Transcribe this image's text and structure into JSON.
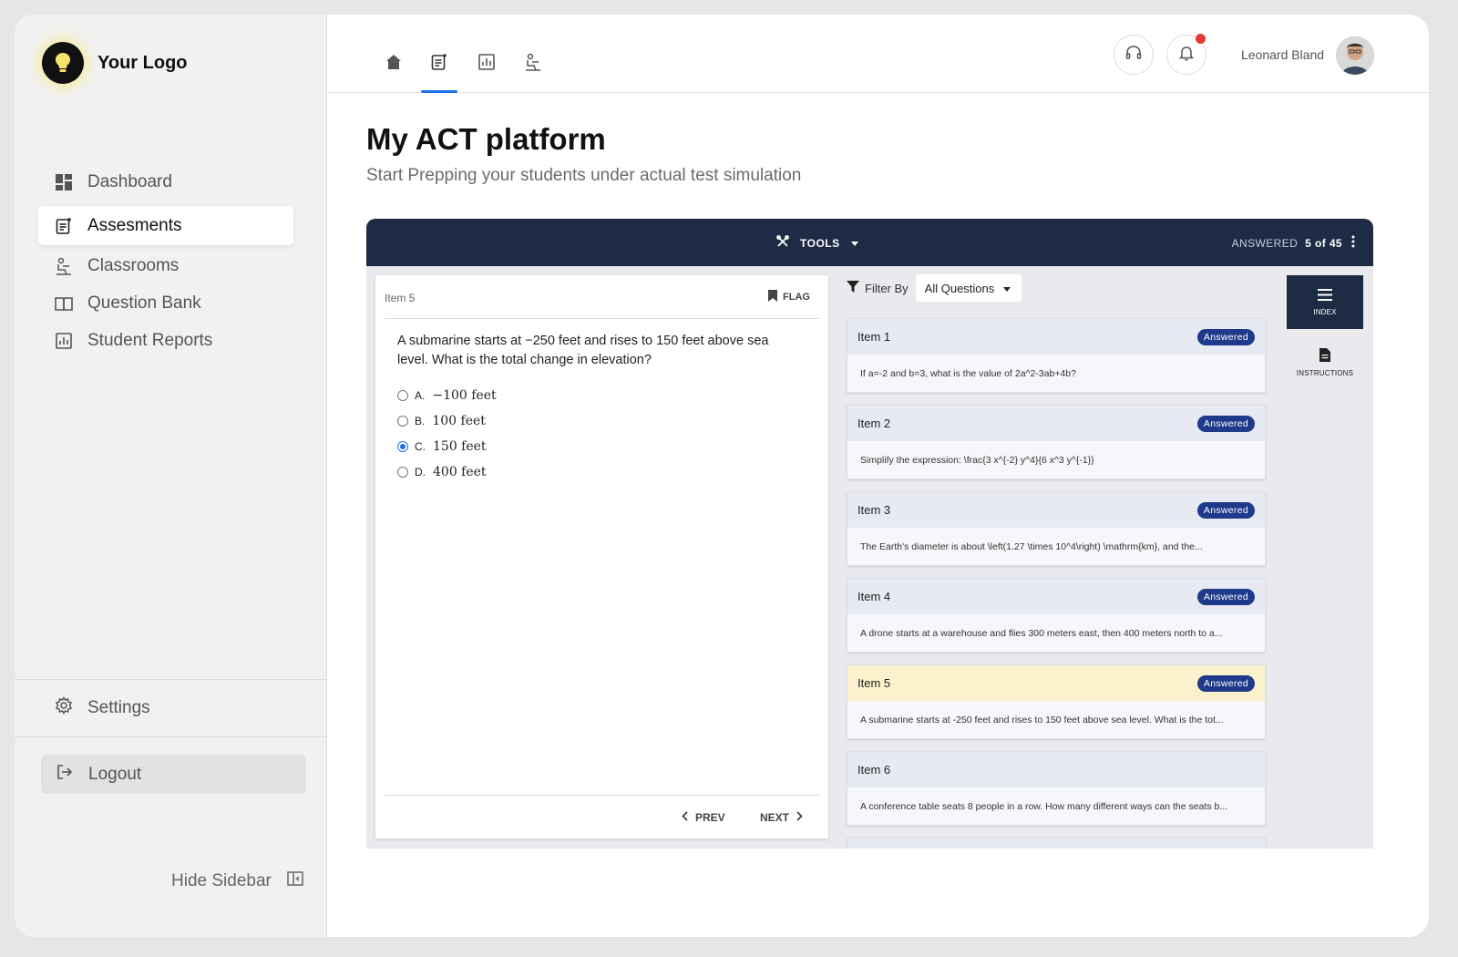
{
  "brand": {
    "logo_text": "Your Logo"
  },
  "sidebar": {
    "items": [
      {
        "label": "Dashboard",
        "icon": "dashboard-icon"
      },
      {
        "label": "Assesments",
        "icon": "assessment-icon",
        "active": true
      },
      {
        "label": "Classrooms",
        "icon": "classroom-icon"
      },
      {
        "label": "Question Bank",
        "icon": "book-icon"
      },
      {
        "label": "Student Reports",
        "icon": "report-icon"
      }
    ],
    "settings_label": "Settings",
    "logout_label": "Logout",
    "hide_label": "Hide Sidebar"
  },
  "topbar": {
    "tabs": [
      "home-icon",
      "assessment-icon",
      "report-icon",
      "classroom-icon"
    ],
    "user_name": "Leonard Bland"
  },
  "page": {
    "title": "My ACT platform",
    "subtitle": "Start Prepping your students under actual test simulation"
  },
  "test": {
    "tools_label": "TOOLS",
    "answered_label": "ANSWERED",
    "answered_count": "5 of 45",
    "current_item": "Item 5",
    "flag_label": "FLAG",
    "question_text": "A submarine starts at −250 feet and rises to 150 feet above sea level. What is the total change in elevation?",
    "options": [
      {
        "letter": "A.",
        "value": "−100 feet",
        "selected": false
      },
      {
        "letter": "B.",
        "value": "100 feet",
        "selected": false
      },
      {
        "letter": "C.",
        "value": "150 feet",
        "selected": true
      },
      {
        "letter": "D.",
        "value": "400 feet",
        "selected": false
      }
    ],
    "prev_label": "PREV",
    "next_label": "NEXT",
    "filter_label": "Filter By",
    "filter_value": "All Questions",
    "items": [
      {
        "title": "Item 1",
        "status": "Answered",
        "text": "If a=-2 and b=3, what is the value of 2a^2-3ab+4b?"
      },
      {
        "title": "Item 2",
        "status": "Answered",
        "text": "Simplify the expression: \\frac{3 x^{-2} y^4}{6 x^3 y^{-1}}"
      },
      {
        "title": "Item 3",
        "status": "Answered",
        "text": "The Earth's diameter is about \\left(1.27 \\times 10^4\\right) \\mathrm{km}, and the..."
      },
      {
        "title": "Item 4",
        "status": "Answered",
        "text": "A drone starts at a warehouse and flies 300 meters east, then 400 meters north to a..."
      },
      {
        "title": "Item 5",
        "status": "Answered",
        "text": "A submarine starts at -250 feet and rises to 150 feet above sea level. What is the tot..."
      },
      {
        "title": "Item 6",
        "status": "",
        "text": "A conference table seats 8 people in a row. How many different ways can the seats b..."
      }
    ],
    "index_label": "INDEX",
    "instructions_label": "INSTRUCTIONS"
  },
  "colors": {
    "panel_header": "#1d2b44",
    "badge": "#1f3a8a",
    "accent": "#1a73e8",
    "current_item_bg": "#fbf1cc",
    "notification": "#e53935"
  }
}
